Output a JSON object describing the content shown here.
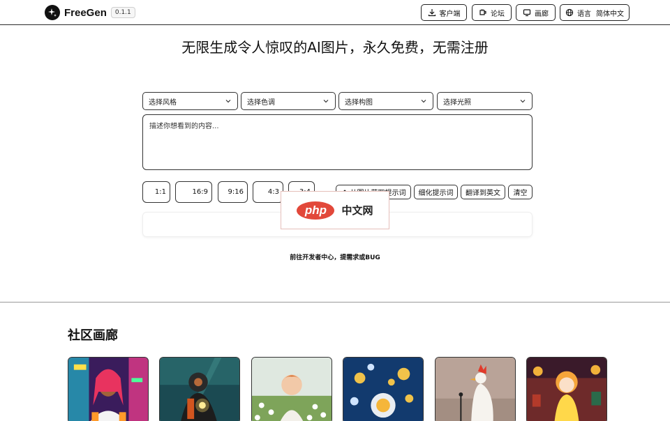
{
  "header": {
    "brand": "FreeGen",
    "version": "0.1.1",
    "nav": {
      "client": "客户端",
      "forum": "论坛",
      "gallery": "画廊",
      "language_label": "语言",
      "language_value": "简体中文"
    }
  },
  "headline": "无限生成令人惊叹的AI图片，永久免费，无需注册",
  "selects": {
    "style": "选择风格",
    "color": "选择色调",
    "composition": "选择构图",
    "lighting": "选择光照"
  },
  "prompt": {
    "placeholder": "描述你想看到的内容..."
  },
  "ratios": [
    "1:1",
    "16:9",
    "9:16",
    "4:3",
    "3:4"
  ],
  "tools": {
    "from_image": "从图片获取提示词",
    "refine": "细化提示词",
    "translate": "翻译到英文",
    "clear": "清空"
  },
  "watermark": {
    "logo": "php",
    "text": "中文网"
  },
  "dev_link": "前往开发者中心，提需求或BUG",
  "gallery": {
    "title": "社区画廊",
    "items": [
      "neon-portrait",
      "welder-underwater",
      "baby-in-flowers",
      "gems-on-blue",
      "rooster-microphone",
      "anime-girl-lanterns"
    ]
  },
  "colors": {
    "accent": "#111111",
    "watermark_red": "#e2483a"
  }
}
